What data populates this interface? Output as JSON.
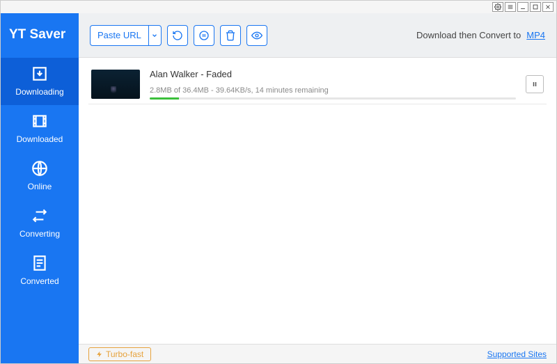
{
  "app": {
    "name": "YT Saver"
  },
  "sidebar": {
    "items": [
      {
        "label": "Downloading"
      },
      {
        "label": "Downloaded"
      },
      {
        "label": "Online"
      },
      {
        "label": "Converting"
      },
      {
        "label": "Converted"
      }
    ]
  },
  "toolbar": {
    "paste_label": "Paste URL",
    "convert_label": "Download then Convert to",
    "format": "MP4"
  },
  "downloads": [
    {
      "title": "Alan Walker - Faded",
      "status": "2.8MB of 36.4MB - 39.64KB/s, 14 minutes remaining",
      "progress_pct": 8
    }
  ],
  "footer": {
    "turbo_label": "Turbo-fast",
    "sites_label": "Supported Sites"
  }
}
